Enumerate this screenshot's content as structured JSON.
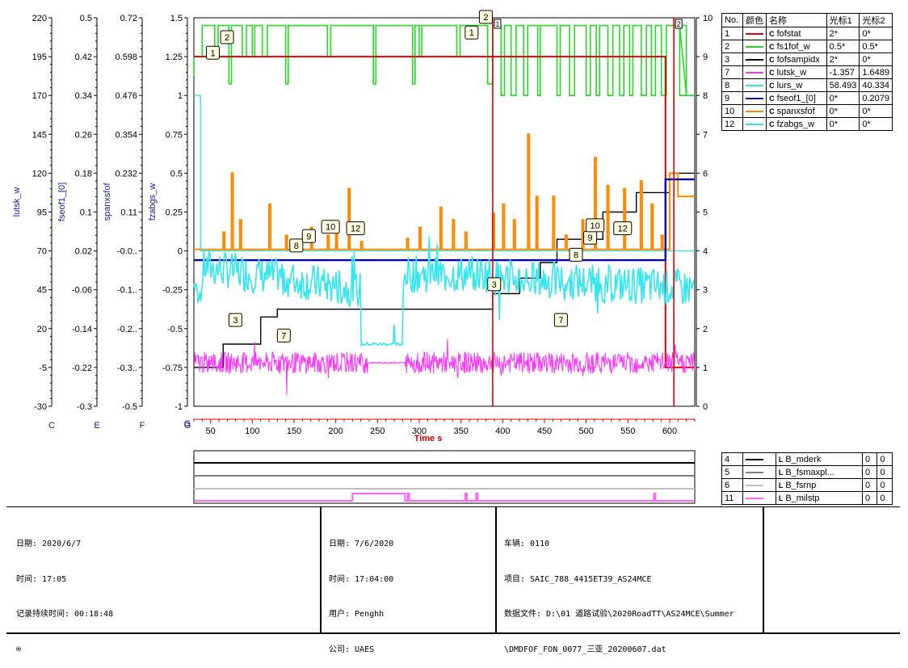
{
  "chart_data": {
    "type": "line",
    "xlabel": "Time s",
    "xlim": [
      30,
      630
    ],
    "x_ticks": [
      50,
      100,
      150,
      200,
      250,
      300,
      350,
      400,
      450,
      500,
      550,
      600
    ],
    "axes": [
      {
        "id": "C",
        "name": "lutsk_w",
        "ticks": [
          "220",
          "195",
          "170",
          "145",
          "120",
          "95",
          "70",
          "45",
          "20",
          "-5",
          "-30"
        ]
      },
      {
        "id": "E",
        "name": "fseof1_[0]",
        "ticks": [
          "0.5",
          "0.42",
          "0.34",
          "0.26",
          "0.18",
          "0.1",
          "0.02",
          "-0.06",
          "-0.14",
          "-0.22",
          "-0.3"
        ]
      },
      {
        "id": "F",
        "name": "spanxsfof",
        "ticks": [
          "0.72",
          "0.598",
          "0.476",
          "0.354",
          "0.232",
          "0.11",
          "-0.0..",
          "-0.1..",
          "-0.2..",
          "-0.3..",
          "-0.5"
        ]
      },
      {
        "id": "G",
        "name": "fzabgs_w",
        "ticks": [
          "1.5",
          "1.25",
          "1",
          "0.75",
          "0.5",
          "0.25",
          "0",
          "-0.25",
          "-0.5",
          "-0.75",
          "-1"
        ]
      }
    ],
    "right_axis_ticks": [
      "10",
      "9",
      "8",
      "7",
      "6",
      "5",
      "4",
      "3",
      "2",
      "1",
      "0"
    ],
    "cursors": [
      {
        "label": "1",
        "x": 388
      },
      {
        "label": "2",
        "x": 605
      }
    ],
    "series": [
      {
        "no": "1",
        "name": "fofstat",
        "color": "#e00000",
        "cursor1": "2*",
        "cursor2": "0*"
      },
      {
        "no": "2",
        "name": "fs1fof_w",
        "color": "#22dd22",
        "cursor1": "0.5*",
        "cursor2": "0.5*"
      },
      {
        "no": "3",
        "name": "fofsampidx",
        "color": "#000000",
        "cursor1": "2*",
        "cursor2": "0*"
      },
      {
        "no": "7",
        "name": "lutsk_w",
        "color": "#ff33ff",
        "cursor1": "-1.357",
        "cursor2": "1.6489"
      },
      {
        "no": "8",
        "name": "lurs_w",
        "color": "#33e6f0",
        "cursor1": "58.493",
        "cursor2": "40.334"
      },
      {
        "no": "9",
        "name": "fseof1_[0]",
        "color": "#0000cc",
        "cursor1": "0*",
        "cursor2": "0.2079"
      },
      {
        "no": "10",
        "name": "spanxsfof",
        "color": "#ff8800",
        "cursor1": "0*",
        "cursor2": "0*"
      },
      {
        "no": "12",
        "name": "fzabgs_w",
        "color": "#33e6f0",
        "cursor1": "0*",
        "cursor2": "0*"
      }
    ],
    "digital_series": [
      {
        "no": "4",
        "name": "B_mderk",
        "color": "#000000",
        "cursor1": "0",
        "cursor2": "0"
      },
      {
        "no": "5",
        "name": "B_fsmaxpl...",
        "color": "#808080",
        "cursor1": "0",
        "cursor2": "0"
      },
      {
        "no": "6",
        "name": "B_fsrnp",
        "color": "#c0c0c0",
        "cursor1": "0",
        "cursor2": "0"
      },
      {
        "no": "11",
        "name": "B_milstp",
        "color": "#ff66ff",
        "cursor1": "0",
        "cursor2": "0"
      }
    ],
    "step_fofsampidx": [
      [
        30,
        1
      ],
      [
        65,
        1
      ],
      [
        65,
        1.6
      ],
      [
        110,
        1.6
      ],
      [
        110,
        2.3
      ],
      [
        130,
        2.3
      ],
      [
        130,
        2.5
      ],
      [
        388,
        2.5
      ],
      [
        388,
        2.9
      ],
      [
        420,
        2.9
      ],
      [
        420,
        3.3
      ],
      [
        445,
        3.3
      ],
      [
        445,
        3.7
      ],
      [
        465,
        3.7
      ],
      [
        465,
        4.3
      ],
      [
        520,
        4.3
      ],
      [
        520,
        5
      ],
      [
        560,
        5
      ],
      [
        560,
        5.5
      ],
      [
        600,
        5.5
      ],
      [
        600,
        6.0
      ],
      [
        640,
        6.0
      ]
    ],
    "step_fseof1": [
      [
        30,
        -0.06
      ],
      [
        595,
        -0.06
      ],
      [
        595,
        0.2079
      ],
      [
        630,
        0.2079
      ]
    ],
    "step_fofstat": [
      [
        30,
        1.25
      ],
      [
        595,
        1.25
      ],
      [
        595,
        -0.75
      ],
      [
        630,
        -0.75
      ]
    ]
  },
  "legend": {
    "headers": [
      "No.",
      "颜色",
      "名称",
      "光标1",
      "光标2"
    ],
    "icon": "C",
    "dig_icon": "L"
  },
  "info": {
    "col1": [
      "日期: 2020/6/7",
      "时间: 17:05",
      "记录持续时间: 00:18:48",
      "®"
    ],
    "col2": [
      "日期: 7/6/2020",
      "时间: 17:04:00",
      "用户: Penghh",
      "公司: UAES"
    ],
    "col3": [
      "车辆: 0110",
      "项目: SAIC_788_4415ET39_AS24MCE",
      "数据文件: D:\\01 道路试验\\2020RoadTT\\AS24MCE\\Summer",
      "\\DMDFOF_FON_0077_三亚_20200607.dat"
    ]
  },
  "markers": {
    "m1": "1",
    "m2": "2",
    "m3": "3",
    "m7": "7",
    "m8": "8",
    "m9": "9",
    "m10": "10",
    "m12": "12"
  }
}
